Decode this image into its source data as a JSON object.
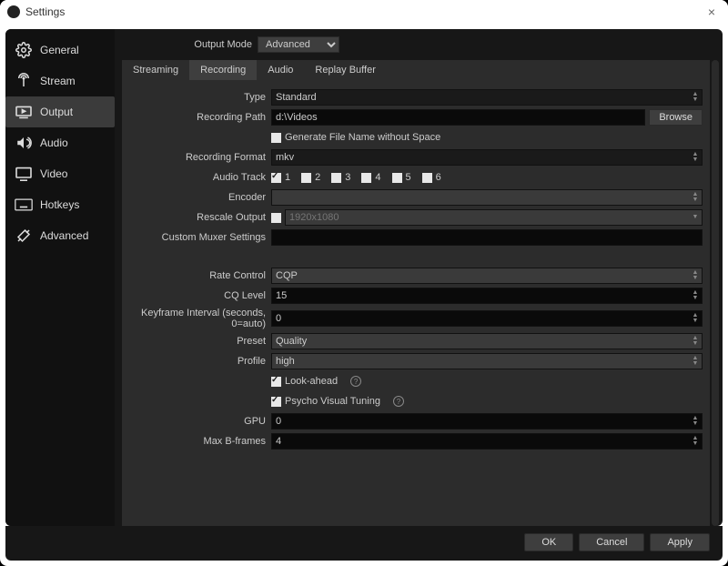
{
  "window": {
    "title": "Settings"
  },
  "sidebar": {
    "items": [
      {
        "label": "General"
      },
      {
        "label": "Stream"
      },
      {
        "label": "Output"
      },
      {
        "label": "Audio"
      },
      {
        "label": "Video"
      },
      {
        "label": "Hotkeys"
      },
      {
        "label": "Advanced"
      }
    ]
  },
  "outputMode": {
    "label": "Output Mode",
    "value": "Advanced"
  },
  "tabs": [
    {
      "label": "Streaming"
    },
    {
      "label": "Recording"
    },
    {
      "label": "Audio"
    },
    {
      "label": "Replay Buffer"
    }
  ],
  "rec": {
    "type": {
      "label": "Type",
      "value": "Standard"
    },
    "path": {
      "label": "Recording Path",
      "value": "d:\\Videos",
      "browse": "Browse"
    },
    "nospace": {
      "label": "Generate File Name without Space",
      "checked": false
    },
    "format": {
      "label": "Recording Format",
      "value": "mkv"
    },
    "audiotrack": {
      "label": "Audio Track",
      "n1": "1",
      "n2": "2",
      "n3": "3",
      "n4": "4",
      "n5": "5",
      "n6": "6"
    },
    "encoder": {
      "label": "Encoder",
      "value": ""
    },
    "rescale": {
      "label": "Rescale Output",
      "placeholder": "1920x1080",
      "checked": false
    },
    "muxer": {
      "label": "Custom Muxer Settings",
      "value": ""
    }
  },
  "enc": {
    "rate": {
      "label": "Rate Control",
      "value": "CQP"
    },
    "cq": {
      "label": "CQ Level",
      "value": "15"
    },
    "keyf": {
      "label": "Keyframe Interval (seconds, 0=auto)",
      "value": "0"
    },
    "preset": {
      "label": "Preset",
      "value": "Quality"
    },
    "profile": {
      "label": "Profile",
      "value": "high"
    },
    "lookahead": {
      "label": "Look-ahead",
      "checked": true
    },
    "psycho": {
      "label": "Psycho Visual Tuning",
      "checked": true
    },
    "gpu": {
      "label": "GPU",
      "value": "0"
    },
    "bframes": {
      "label": "Max B-frames",
      "value": "4"
    }
  },
  "footer": {
    "ok": "OK",
    "cancel": "Cancel",
    "apply": "Apply"
  }
}
